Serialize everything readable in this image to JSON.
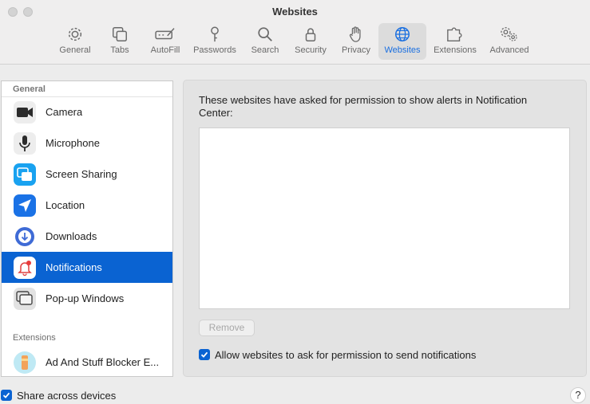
{
  "window": {
    "title": "Websites"
  },
  "toolbar": {
    "items": [
      {
        "label": "General",
        "icon": "gear-icon"
      },
      {
        "label": "Tabs",
        "icon": "tabs-icon"
      },
      {
        "label": "AutoFill",
        "icon": "autofill-icon"
      },
      {
        "label": "Passwords",
        "icon": "key-icon"
      },
      {
        "label": "Search",
        "icon": "magnifier-icon"
      },
      {
        "label": "Security",
        "icon": "lock-icon"
      },
      {
        "label": "Privacy",
        "icon": "hand-icon"
      },
      {
        "label": "Websites",
        "icon": "globe-icon",
        "active": true
      },
      {
        "label": "Extensions",
        "icon": "puzzle-icon"
      },
      {
        "label": "Advanced",
        "icon": "gears-icon"
      }
    ],
    "active_color": "#1a6fe0"
  },
  "sidebar": {
    "general_header": "General",
    "items": [
      {
        "label": "Camera",
        "icon": "camera-icon"
      },
      {
        "label": "Microphone",
        "icon": "microphone-icon"
      },
      {
        "label": "Screen Sharing",
        "icon": "screen-sharing-icon"
      },
      {
        "label": "Location",
        "icon": "location-arrow-icon"
      },
      {
        "label": "Downloads",
        "icon": "download-icon"
      },
      {
        "label": "Notifications",
        "icon": "bell-icon",
        "selected": true
      },
      {
        "label": "Pop-up Windows",
        "icon": "popup-windows-icon"
      }
    ],
    "extensions_header": "Extensions",
    "extension_items": [
      {
        "label": "Ad And Stuff Blocker E...",
        "icon": "extension-app-icon"
      }
    ],
    "selected_color": "#0a63d2"
  },
  "main": {
    "description": "These websites have asked for permission to show alerts in Notification Center:",
    "remove_label": "Remove",
    "allow_label": "Allow websites to ask for permission to send notifications",
    "allow_checked": true
  },
  "footer": {
    "share_label": "Share across devices",
    "share_checked": true,
    "help_label": "?"
  }
}
